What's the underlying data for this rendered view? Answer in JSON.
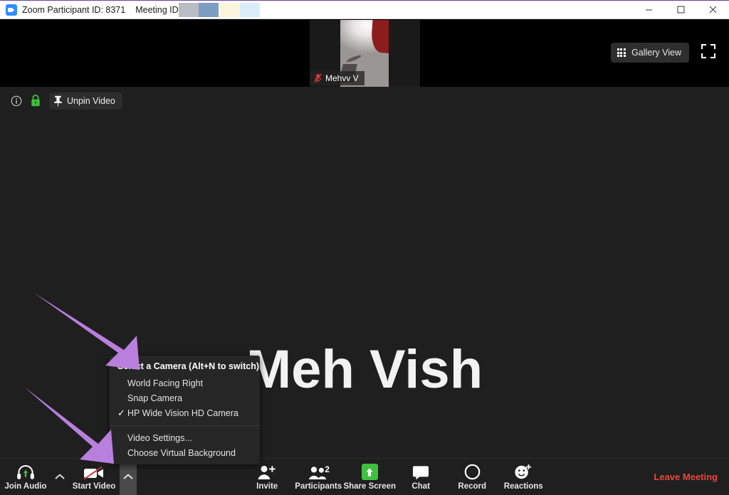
{
  "window": {
    "app_icon": "zoom-icon",
    "title": "Zoom Participant ID: 8371",
    "meeting_id_label": "Meeting ID",
    "meeting_id_redacted": true,
    "redaction_colors": [
      "#b9bcc2",
      "#7e9dc4",
      "#faf4dd",
      "#d9edf8"
    ],
    "minimize_label": "Minimize",
    "maximize_label": "Maximize",
    "close_label": "Close"
  },
  "thumbnail_strip": {
    "participant_name": "Mehvv V",
    "muted": true,
    "mute_icon": "microphone-muted-icon"
  },
  "view_controls": {
    "gallery_view_label": "Gallery View",
    "gallery_icon": "grid-icon",
    "fullscreen_icon": "enter-fullscreen-icon"
  },
  "pin_bar": {
    "info_icon": "info-circle-icon",
    "lock_icon": "green-lock-icon",
    "lock_color": "#3ec13e",
    "pin_icon": "pin-icon",
    "unpin_label": "Unpin Video"
  },
  "stage": {
    "display_name": "Meh Vish"
  },
  "camera_menu": {
    "header": "Select a Camera (Alt+N to switch)",
    "items": [
      {
        "label": "World Facing Right",
        "checked": false
      },
      {
        "label": "Snap Camera",
        "checked": false
      },
      {
        "label": "HP Wide Vision HD Camera",
        "checked": true
      }
    ],
    "footer_items": [
      {
        "label": "Video Settings..."
      },
      {
        "label": "Choose Virtual Background"
      }
    ],
    "check_glyph": "✓"
  },
  "toolbar": {
    "items": [
      {
        "label": "Join Audio",
        "icon": "headset-icon",
        "has_caret": true,
        "caret_active": false
      },
      {
        "label": "Start Video",
        "icon": "video-off-icon",
        "has_caret": true,
        "caret_active": true
      },
      {
        "label": "Invite",
        "icon": "person-add-icon",
        "has_caret": false
      },
      {
        "label": "Participants",
        "icon": "people-icon",
        "badge": "2",
        "has_caret": false
      },
      {
        "label": "Share Screen",
        "icon": "share-screen-icon",
        "has_caret": false
      },
      {
        "label": "Chat",
        "icon": "chat-bubble-icon",
        "has_caret": false
      },
      {
        "label": "Record",
        "icon": "record-circle-icon",
        "has_caret": false
      },
      {
        "label": "Reactions",
        "icon": "reactions-smiley-icon",
        "has_caret": false
      }
    ],
    "leave_label": "Leave Meeting",
    "leave_color": "#e8463c",
    "share_accent": "#3ec13e"
  },
  "annotations": {
    "arrow_color": "#b97fdd",
    "arrows": [
      {
        "name": "arrow-to-world-facing-right",
        "points_to": "World Facing Right"
      },
      {
        "name": "arrow-to-video-caret",
        "points_to": "Start Video caret"
      }
    ]
  }
}
